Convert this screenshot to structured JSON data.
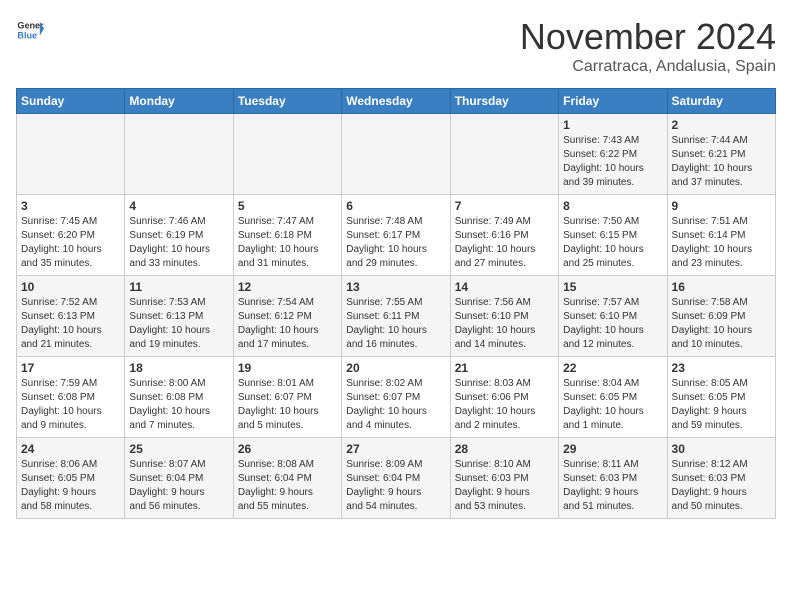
{
  "logo": {
    "general": "General",
    "blue": "Blue"
  },
  "header": {
    "month": "November 2024",
    "location": "Carratraca, Andalusia, Spain"
  },
  "weekdays": [
    "Sunday",
    "Monday",
    "Tuesday",
    "Wednesday",
    "Thursday",
    "Friday",
    "Saturday"
  ],
  "weeks": [
    [
      {
        "day": "",
        "info": ""
      },
      {
        "day": "",
        "info": ""
      },
      {
        "day": "",
        "info": ""
      },
      {
        "day": "",
        "info": ""
      },
      {
        "day": "",
        "info": ""
      },
      {
        "day": "1",
        "info": "Sunrise: 7:43 AM\nSunset: 6:22 PM\nDaylight: 10 hours\nand 39 minutes."
      },
      {
        "day": "2",
        "info": "Sunrise: 7:44 AM\nSunset: 6:21 PM\nDaylight: 10 hours\nand 37 minutes."
      }
    ],
    [
      {
        "day": "3",
        "info": "Sunrise: 7:45 AM\nSunset: 6:20 PM\nDaylight: 10 hours\nand 35 minutes."
      },
      {
        "day": "4",
        "info": "Sunrise: 7:46 AM\nSunset: 6:19 PM\nDaylight: 10 hours\nand 33 minutes."
      },
      {
        "day": "5",
        "info": "Sunrise: 7:47 AM\nSunset: 6:18 PM\nDaylight: 10 hours\nand 31 minutes."
      },
      {
        "day": "6",
        "info": "Sunrise: 7:48 AM\nSunset: 6:17 PM\nDaylight: 10 hours\nand 29 minutes."
      },
      {
        "day": "7",
        "info": "Sunrise: 7:49 AM\nSunset: 6:16 PM\nDaylight: 10 hours\nand 27 minutes."
      },
      {
        "day": "8",
        "info": "Sunrise: 7:50 AM\nSunset: 6:15 PM\nDaylight: 10 hours\nand 25 minutes."
      },
      {
        "day": "9",
        "info": "Sunrise: 7:51 AM\nSunset: 6:14 PM\nDaylight: 10 hours\nand 23 minutes."
      }
    ],
    [
      {
        "day": "10",
        "info": "Sunrise: 7:52 AM\nSunset: 6:13 PM\nDaylight: 10 hours\nand 21 minutes."
      },
      {
        "day": "11",
        "info": "Sunrise: 7:53 AM\nSunset: 6:13 PM\nDaylight: 10 hours\nand 19 minutes."
      },
      {
        "day": "12",
        "info": "Sunrise: 7:54 AM\nSunset: 6:12 PM\nDaylight: 10 hours\nand 17 minutes."
      },
      {
        "day": "13",
        "info": "Sunrise: 7:55 AM\nSunset: 6:11 PM\nDaylight: 10 hours\nand 16 minutes."
      },
      {
        "day": "14",
        "info": "Sunrise: 7:56 AM\nSunset: 6:10 PM\nDaylight: 10 hours\nand 14 minutes."
      },
      {
        "day": "15",
        "info": "Sunrise: 7:57 AM\nSunset: 6:10 PM\nDaylight: 10 hours\nand 12 minutes."
      },
      {
        "day": "16",
        "info": "Sunrise: 7:58 AM\nSunset: 6:09 PM\nDaylight: 10 hours\nand 10 minutes."
      }
    ],
    [
      {
        "day": "17",
        "info": "Sunrise: 7:59 AM\nSunset: 6:08 PM\nDaylight: 10 hours\nand 9 minutes."
      },
      {
        "day": "18",
        "info": "Sunrise: 8:00 AM\nSunset: 6:08 PM\nDaylight: 10 hours\nand 7 minutes."
      },
      {
        "day": "19",
        "info": "Sunrise: 8:01 AM\nSunset: 6:07 PM\nDaylight: 10 hours\nand 5 minutes."
      },
      {
        "day": "20",
        "info": "Sunrise: 8:02 AM\nSunset: 6:07 PM\nDaylight: 10 hours\nand 4 minutes."
      },
      {
        "day": "21",
        "info": "Sunrise: 8:03 AM\nSunset: 6:06 PM\nDaylight: 10 hours\nand 2 minutes."
      },
      {
        "day": "22",
        "info": "Sunrise: 8:04 AM\nSunset: 6:05 PM\nDaylight: 10 hours\nand 1 minute."
      },
      {
        "day": "23",
        "info": "Sunrise: 8:05 AM\nSunset: 6:05 PM\nDaylight: 9 hours\nand 59 minutes."
      }
    ],
    [
      {
        "day": "24",
        "info": "Sunrise: 8:06 AM\nSunset: 6:05 PM\nDaylight: 9 hours\nand 58 minutes."
      },
      {
        "day": "25",
        "info": "Sunrise: 8:07 AM\nSunset: 6:04 PM\nDaylight: 9 hours\nand 56 minutes."
      },
      {
        "day": "26",
        "info": "Sunrise: 8:08 AM\nSunset: 6:04 PM\nDaylight: 9 hours\nand 55 minutes."
      },
      {
        "day": "27",
        "info": "Sunrise: 8:09 AM\nSunset: 6:04 PM\nDaylight: 9 hours\nand 54 minutes."
      },
      {
        "day": "28",
        "info": "Sunrise: 8:10 AM\nSunset: 6:03 PM\nDaylight: 9 hours\nand 53 minutes."
      },
      {
        "day": "29",
        "info": "Sunrise: 8:11 AM\nSunset: 6:03 PM\nDaylight: 9 hours\nand 51 minutes."
      },
      {
        "day": "30",
        "info": "Sunrise: 8:12 AM\nSunset: 6:03 PM\nDaylight: 9 hours\nand 50 minutes."
      }
    ]
  ]
}
